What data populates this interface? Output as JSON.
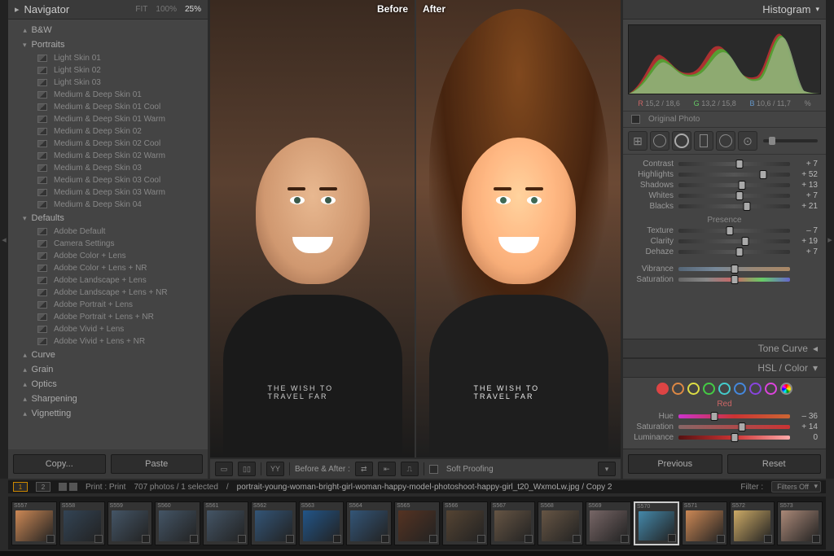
{
  "navigator": {
    "title": "Navigator",
    "zoom_levels": [
      "FIT",
      "100%",
      "25%"
    ],
    "zoom_active": 2
  },
  "preset_groups": [
    {
      "name": "B&W",
      "collapsed": true,
      "items": []
    },
    {
      "name": "Portraits",
      "collapsed": false,
      "items": [
        "Light Skin 01",
        "Light Skin 02",
        "Light Skin 03",
        "Medium & Deep Skin 01",
        "Medium & Deep Skin 01 Cool",
        "Medium & Deep Skin 01 Warm",
        "Medium & Deep Skin 02",
        "Medium & Deep Skin 02 Cool",
        "Medium & Deep Skin 02 Warm",
        "Medium & Deep Skin 03",
        "Medium & Deep Skin 03 Cool",
        "Medium & Deep Skin 03 Warm",
        "Medium & Deep Skin 04"
      ]
    },
    {
      "name": "Defaults",
      "collapsed": false,
      "items": [
        "Adobe Default",
        "Camera Settings",
        "Adobe Color + Lens",
        "Adobe Color + Lens + NR",
        "Adobe Landscape + Lens",
        "Adobe Landscape + Lens + NR",
        "Adobe Portrait + Lens",
        "Adobe Portrait + Lens + NR",
        "Adobe Vivid + Lens",
        "Adobe Vivid + Lens + NR"
      ]
    },
    {
      "name": "Curve",
      "collapsed": true,
      "items": []
    },
    {
      "name": "Grain",
      "collapsed": true,
      "items": []
    },
    {
      "name": "Optics",
      "collapsed": true,
      "items": []
    },
    {
      "name": "Sharpening",
      "collapsed": true,
      "items": []
    },
    {
      "name": "Vignetting",
      "collapsed": true,
      "items": []
    }
  ],
  "left_buttons": {
    "copy": "Copy...",
    "paste": "Paste"
  },
  "center": {
    "before_label": "Before",
    "after_label": "After",
    "shirt_text": "THE WISH TO TRAVEL FAR",
    "toolbar_label": "Before & After :",
    "soft_proofing": "Soft Proofing"
  },
  "right": {
    "histogram_title": "Histogram",
    "rgb": {
      "r": "15,2 / 18,6",
      "g": "13,2 / 15,8",
      "b": "10,6 / 11,7",
      "pct": "%"
    },
    "original_photo": "Original Photo",
    "tone_sliders": [
      {
        "label": "Contrast",
        "value": "+ 7",
        "pos": 55
      },
      {
        "label": "Highlights",
        "value": "+ 52",
        "pos": 76
      },
      {
        "label": "Shadows",
        "value": "+ 13",
        "pos": 57
      },
      {
        "label": "Whites",
        "value": "+ 7",
        "pos": 55
      },
      {
        "label": "Blacks",
        "value": "+ 21",
        "pos": 61
      }
    ],
    "presence_title": "Presence",
    "presence_sliders": [
      {
        "label": "Texture",
        "value": "– 7",
        "pos": 46
      },
      {
        "label": "Clarity",
        "value": "+ 19",
        "pos": 60
      },
      {
        "label": "Dehaze",
        "value": "+ 7",
        "pos": 55
      }
    ],
    "vibrance_sliders": [
      {
        "label": "Vibrance",
        "value": "",
        "pos": 50,
        "cls": "vibrance"
      },
      {
        "label": "Saturation",
        "value": "",
        "pos": 50,
        "cls": "saturation"
      }
    ],
    "tone_curve": "Tone Curve",
    "hsl_title": "HSL / Color",
    "hsl_colors": [
      "#d44",
      "#d84",
      "#dd4",
      "#4c4",
      "#4cc",
      "#48d",
      "#84d",
      "#d4d"
    ],
    "hsl_red_title": "Red",
    "hsl_sliders": [
      {
        "label": "Hue",
        "value": "– 36",
        "pos": 32,
        "cls": "red-hue"
      },
      {
        "label": "Saturation",
        "value": "+ 14",
        "pos": 57,
        "cls": "red-sat"
      },
      {
        "label": "Luminance",
        "value": "0",
        "pos": 50,
        "cls": "red-lum"
      }
    ],
    "previous": "Previous",
    "reset": "Reset"
  },
  "info_bar": {
    "pages": [
      "1",
      "2"
    ],
    "print": "Print : Print",
    "count": "707 photos / 1 selected",
    "path": "portrait-young-woman-bright-girl-woman-happy-model-photoshoot-happy-girl_t20_WxmoLw.jpg / Copy 2",
    "filter_label": "Filter :",
    "filter_value": "Filters Off"
  },
  "filmstrip": {
    "start": 557,
    "count": 17,
    "selected": 570,
    "colors": [
      "#c85",
      "#345",
      "#456",
      "#456",
      "#456",
      "#357",
      "#258",
      "#357",
      "#532",
      "#543",
      "#654",
      "#654",
      "#766",
      "#48a",
      "#c85",
      "#ca6",
      "#a87"
    ]
  }
}
